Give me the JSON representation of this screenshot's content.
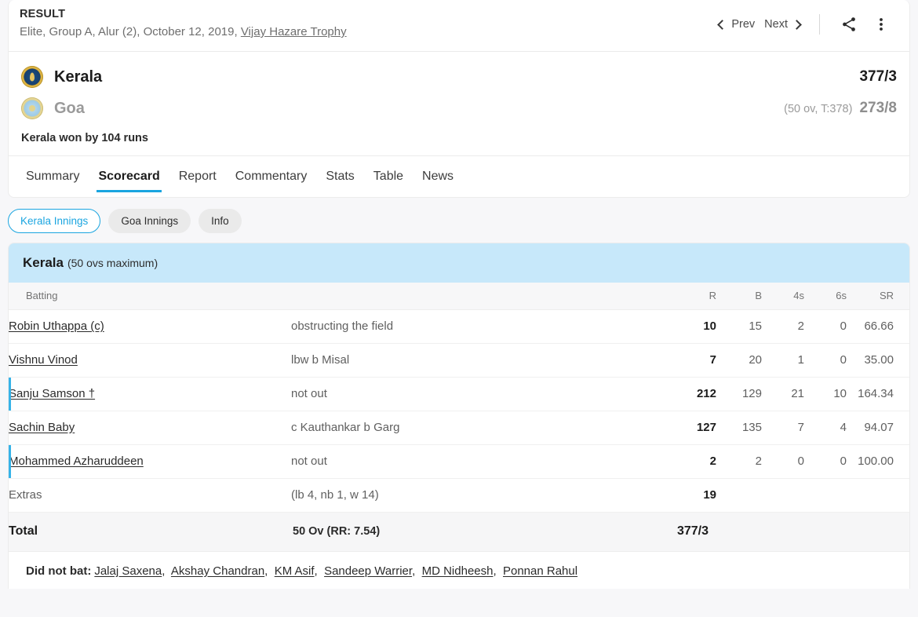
{
  "header": {
    "result_label": "RESULT",
    "meta_prefix": "Elite, Group A, Alur (2), October 12, 2019, ",
    "series": "Vijay Hazare Trophy",
    "prev_label": "Prev",
    "next_label": "Next"
  },
  "teams": {
    "home": {
      "name": "Kerala",
      "score": "377/3",
      "overs_note": ""
    },
    "away": {
      "name": "Goa",
      "score": "273/8",
      "overs_note": "(50 ov, T:378)"
    },
    "result_text": "Kerala won by 104 runs"
  },
  "tabs": [
    {
      "label": "Summary",
      "active": false
    },
    {
      "label": "Scorecard",
      "active": true
    },
    {
      "label": "Report",
      "active": false
    },
    {
      "label": "Commentary",
      "active": false
    },
    {
      "label": "Stats",
      "active": false
    },
    {
      "label": "Table",
      "active": false
    },
    {
      "label": "News",
      "active": false
    }
  ],
  "innings_pills": [
    {
      "label": "Kerala Innings",
      "active": true
    },
    {
      "label": "Goa Innings",
      "active": false
    },
    {
      "label": "Info",
      "active": false
    }
  ],
  "scorecard": {
    "banner_team": "Kerala",
    "banner_overs": "(50 ovs maximum)",
    "columns": {
      "batting": "Batting",
      "r": "R",
      "b": "B",
      "fours": "4s",
      "sixes": "6s",
      "sr": "SR"
    },
    "rows": [
      {
        "name": "Robin Uthappa (c)",
        "dismissal": "obstructing the field",
        "r": "10",
        "b": "15",
        "fours": "2",
        "sixes": "0",
        "sr": "66.66",
        "notout": false,
        "link": true
      },
      {
        "name": "Vishnu Vinod",
        "dismissal": "lbw b Misal",
        "r": "7",
        "b": "20",
        "fours": "1",
        "sixes": "0",
        "sr": "35.00",
        "notout": false,
        "link": true
      },
      {
        "name": "Sanju Samson †",
        "dismissal": "not out",
        "r": "212",
        "b": "129",
        "fours": "21",
        "sixes": "10",
        "sr": "164.34",
        "notout": true,
        "link": true
      },
      {
        "name": "Sachin Baby",
        "dismissal": "c Kauthankar b Garg",
        "r": "127",
        "b": "135",
        "fours": "7",
        "sixes": "4",
        "sr": "94.07",
        "notout": false,
        "link": true
      },
      {
        "name": "Mohammed Azharuddeen",
        "dismissal": "not out",
        "r": "2",
        "b": "2",
        "fours": "0",
        "sixes": "0",
        "sr": "100.00",
        "notout": true,
        "link": true
      },
      {
        "name": "Extras",
        "dismissal": "(lb 4, nb 1, w 14)",
        "r": "19",
        "b": "",
        "fours": "",
        "sixes": "",
        "sr": "",
        "notout": false,
        "link": false
      }
    ],
    "total": {
      "label": "Total",
      "overs": "50 Ov (RR: 7.54)",
      "score": "377/3"
    },
    "did_not_bat": {
      "label": "Did not bat:",
      "players": [
        "Jalaj Saxena",
        "Akshay Chandran",
        "KM Asif",
        "Sandeep Warrier",
        "MD Nidheesh",
        "Ponnan Rahul"
      ]
    }
  },
  "colors": {
    "accent_blue": "#1aa5e0",
    "banner_blue": "#c7e8fa",
    "notout_bar": "#36b3e8"
  }
}
